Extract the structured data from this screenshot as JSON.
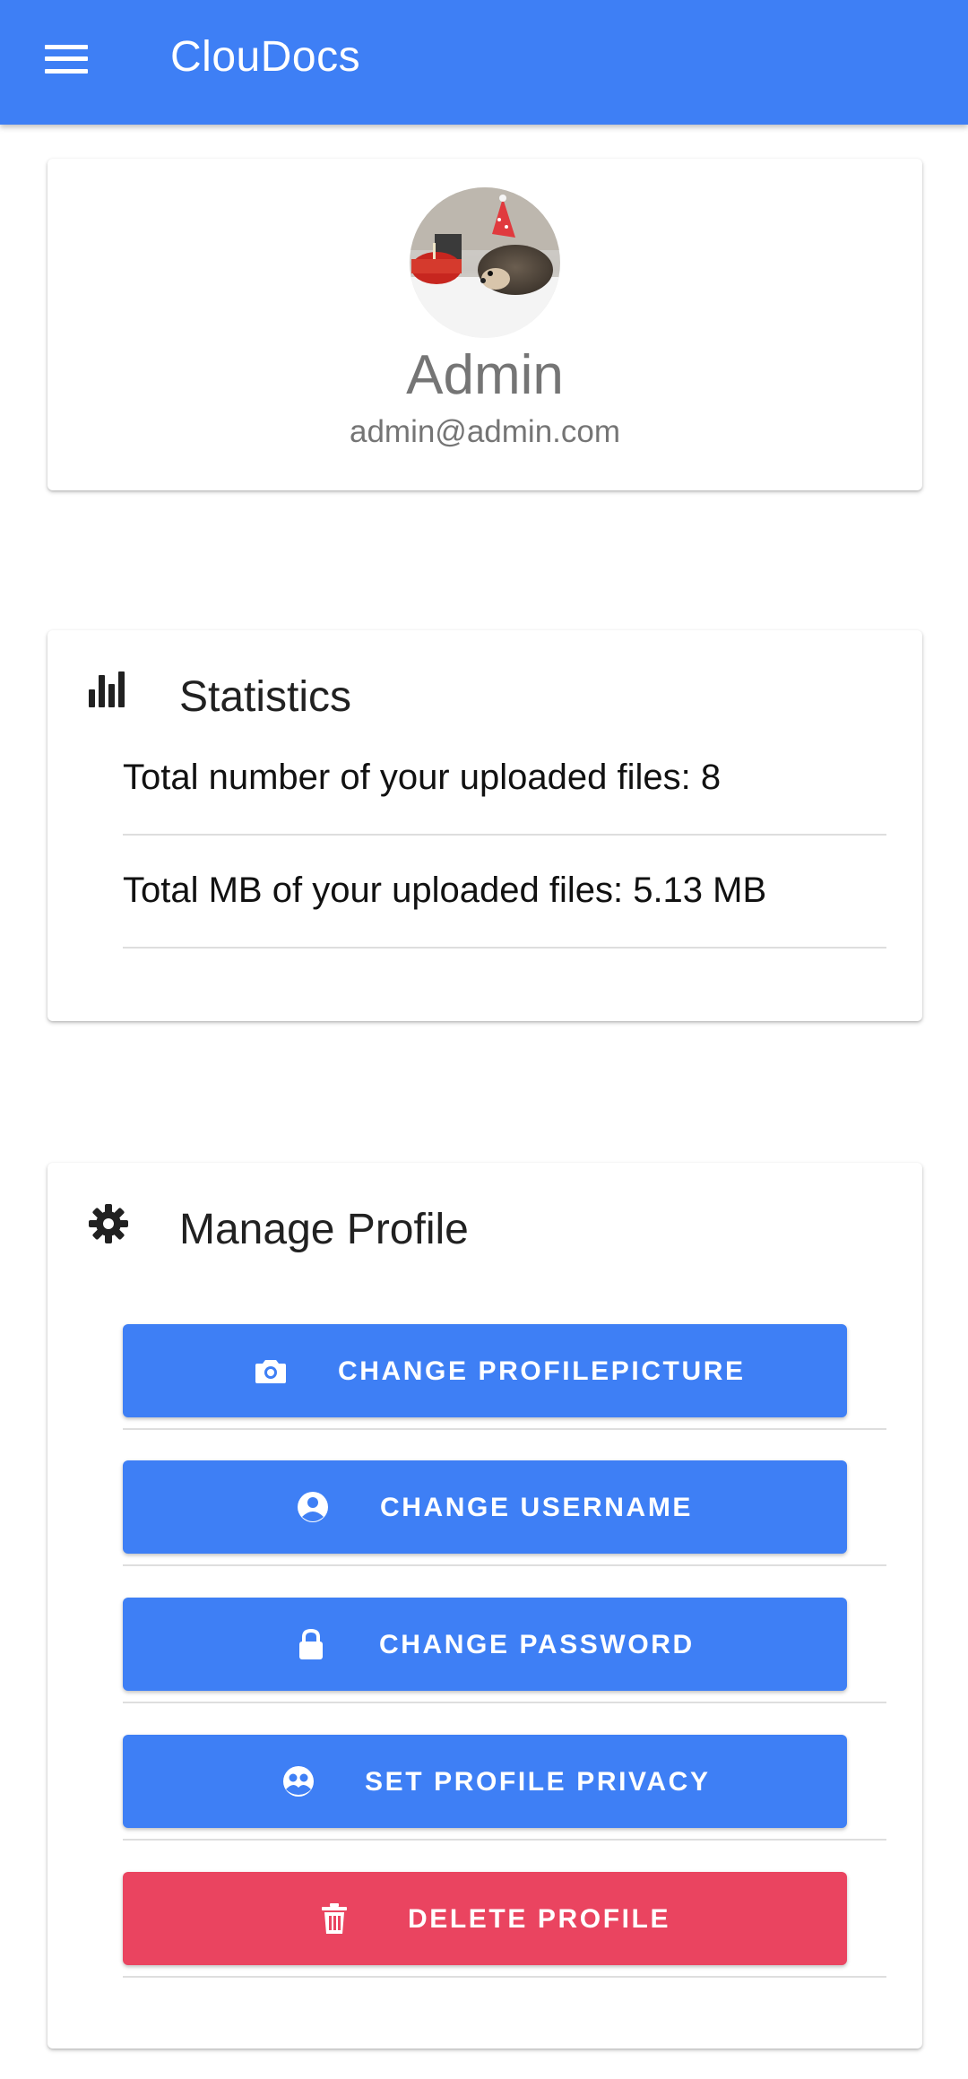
{
  "app": {
    "title": "ClouDocs"
  },
  "profile": {
    "name": "Admin",
    "email": "admin@admin.com",
    "avatar": "hedgehog-party-hat-photo"
  },
  "statistics": {
    "heading": "Statistics",
    "icon": "bar-chart-icon",
    "rows": [
      {
        "text": "Total number of your uploaded files: 8"
      },
      {
        "text": "Total MB of your uploaded files: 5.13 MB"
      }
    ]
  },
  "manage": {
    "heading": "Manage Profile",
    "icon": "gear-icon",
    "buttons": [
      {
        "label": "CHANGE PROFILEPICTURE",
        "icon": "camera-icon"
      },
      {
        "label": "CHANGE USERNAME",
        "icon": "account-circle-icon"
      },
      {
        "label": "CHANGE PASSWORD",
        "icon": "lock-icon"
      },
      {
        "label": "SET PROFILE PRIVACY",
        "icon": "privacy-icon"
      },
      {
        "label": "DELETE PROFILE",
        "icon": "trash-icon"
      }
    ]
  },
  "colors": {
    "primary": "#3e7ff5",
    "danger": "#ea4460",
    "muted_text": "#757575"
  }
}
